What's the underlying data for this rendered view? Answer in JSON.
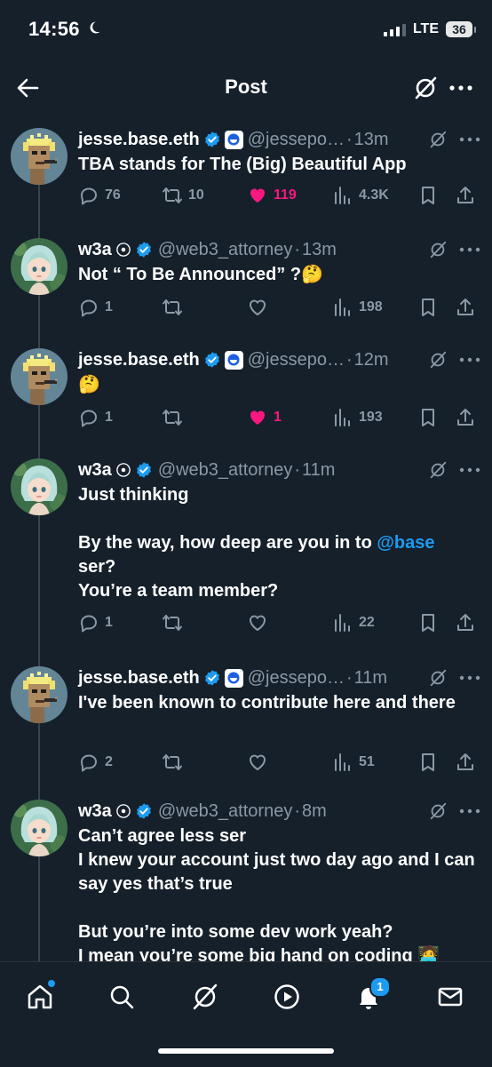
{
  "status_bar": {
    "time": "14:56",
    "network": "LTE",
    "battery": "36"
  },
  "header": {
    "title": "Post"
  },
  "tweets": [
    {
      "name": "jesse.base.eth",
      "handle": "@jessepo…",
      "time": "13m",
      "text": "TBA stands for The (Big) Beautiful App",
      "replies": "76",
      "reposts": "10",
      "likes": "119",
      "liked": true,
      "views": "4.3K"
    },
    {
      "name": "w3a",
      "handle": "@web3_attorney",
      "time": "13m",
      "text": "Not “ To Be Announced” ?🤔",
      "replies": "1",
      "reposts": "",
      "likes": "",
      "liked": false,
      "views": "198"
    },
    {
      "name": "jesse.base.eth",
      "handle": "@jessepo…",
      "time": "12m",
      "text": "🤔",
      "replies": "1",
      "reposts": "",
      "likes": "1",
      "liked": true,
      "views": "193"
    },
    {
      "name": "w3a",
      "handle": "@web3_attorney",
      "time": "11m",
      "text_line1": "Just thinking",
      "text_line2_pre": "By the way, how deep are you in to ",
      "text_mention": "@base",
      "text_line3": "ser?",
      "text_line4": "You’re a team member?",
      "replies": "1",
      "reposts": "",
      "likes": "",
      "liked": false,
      "views": "22"
    },
    {
      "name": "jesse.base.eth",
      "handle": "@jessepo…",
      "time": "11m",
      "text": "I've been known to contribute here and there",
      "replies": "2",
      "reposts": "",
      "likes": "",
      "liked": false,
      "views": "51"
    },
    {
      "name": "w3a",
      "handle": "@web3_attorney",
      "time": "8m",
      "text": "Can’t agree less ser\nI knew your account just two day ago and I can say yes that’s true\n\nBut you’re into some dev work yeah?\nI mean you’re some big hand on coding 🧑‍💻"
    }
  ],
  "tab_bar": {
    "notifications_count": "1"
  },
  "colors": {
    "background": "#15202b",
    "accent": "#1d9bf0",
    "like": "#f91880",
    "muted": "#8b98a5"
  }
}
